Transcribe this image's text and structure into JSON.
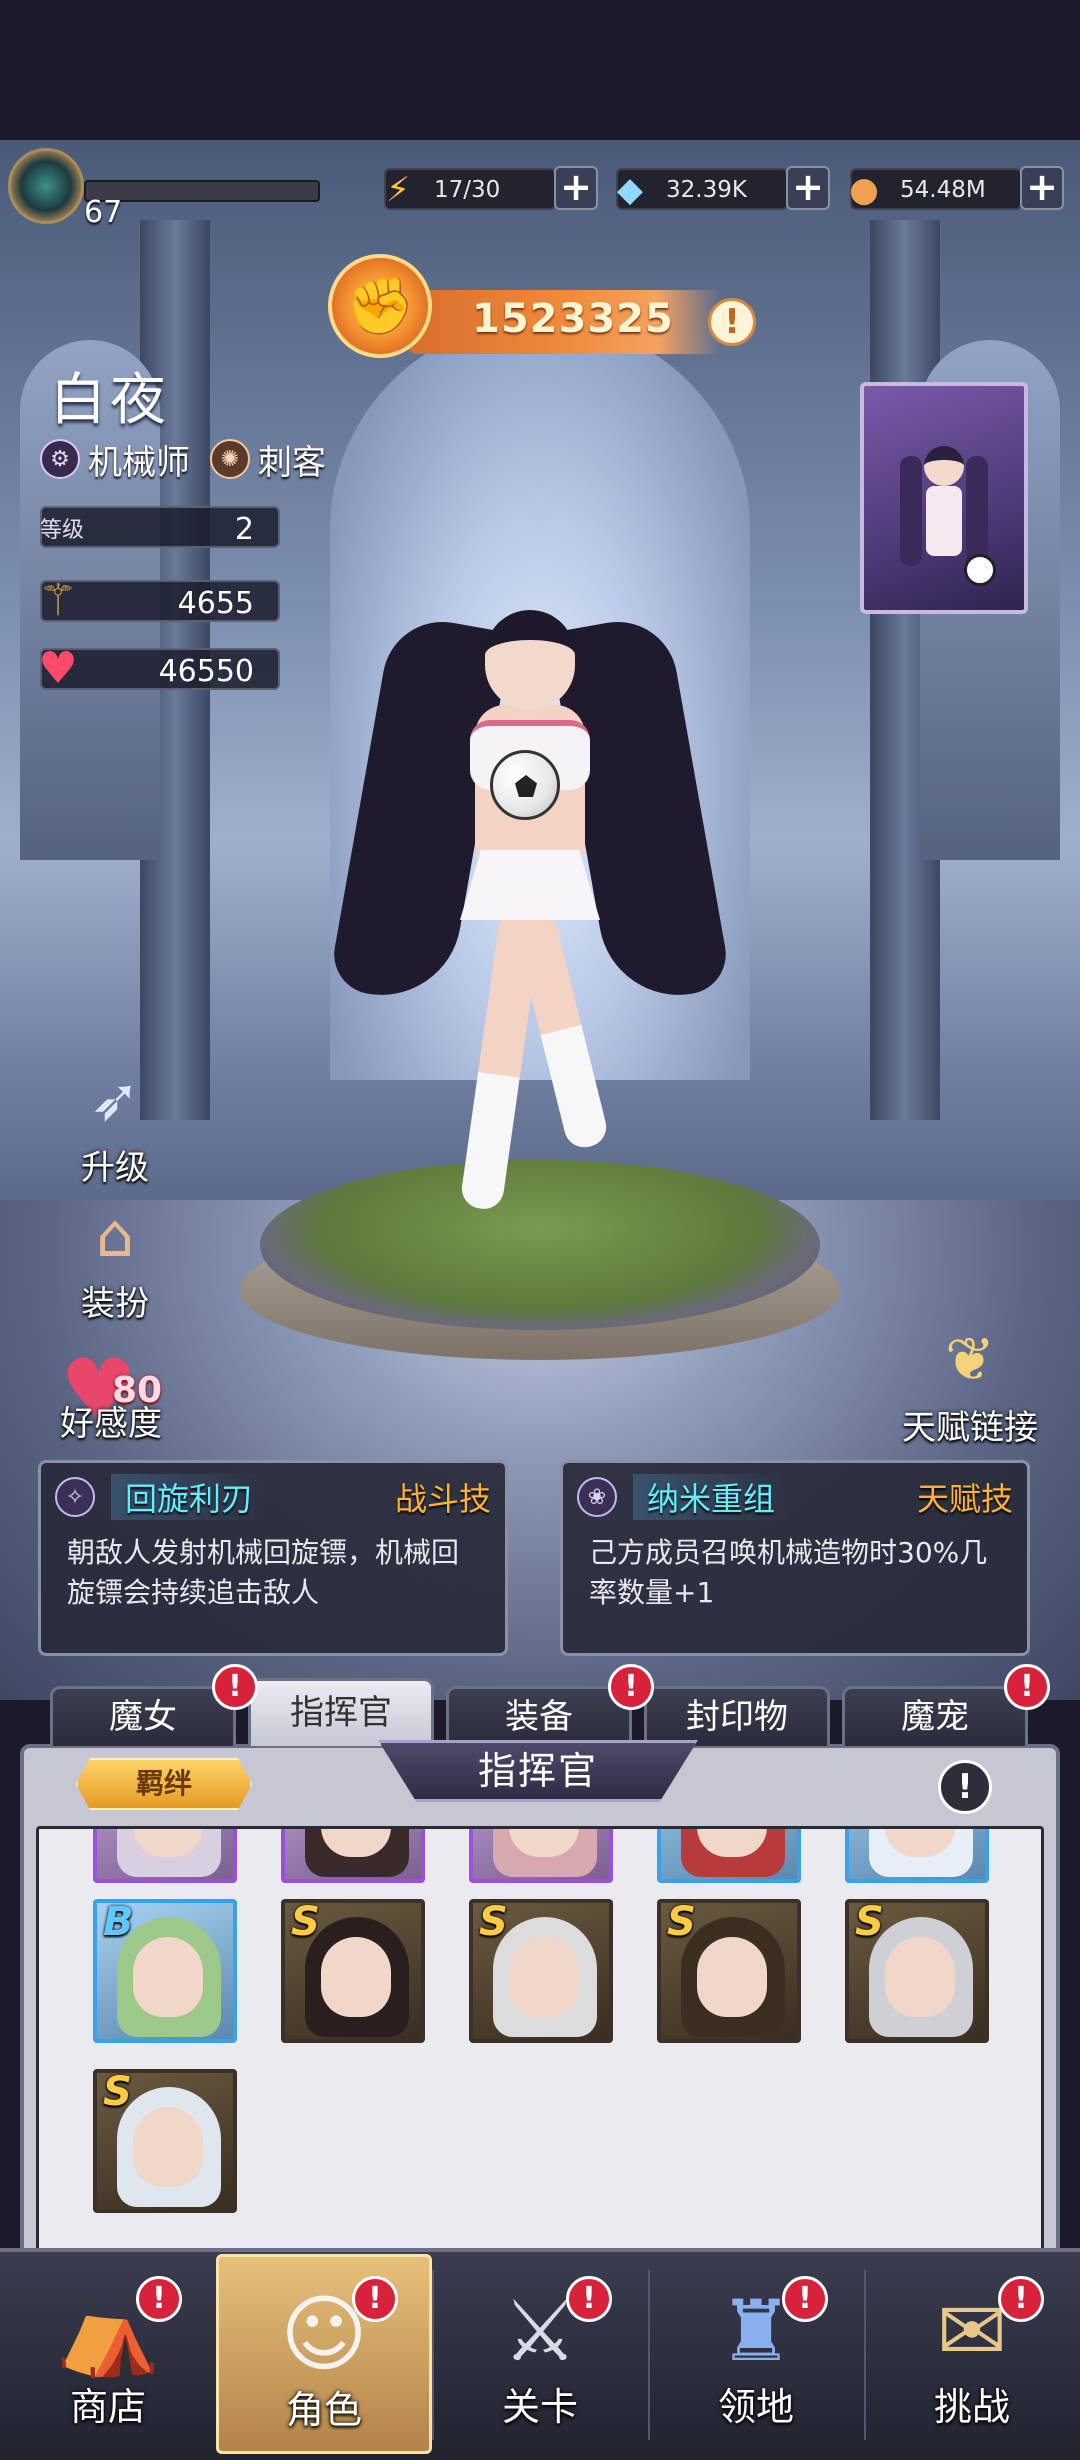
{
  "topbar": {
    "player_level": "67",
    "resources": [
      {
        "icon": "lightning-icon",
        "value": "17/30"
      },
      {
        "icon": "diamond-icon",
        "value": "32.39K"
      },
      {
        "icon": "coin-icon",
        "value": "54.48M"
      }
    ],
    "plus_label": "+"
  },
  "power": {
    "value": "1523325",
    "info": "!"
  },
  "character": {
    "name": "白夜",
    "classes": [
      {
        "icon": "gear-class-icon",
        "label": "机械师"
      },
      {
        "icon": "spiral-class-icon",
        "label": "刺客"
      }
    ],
    "stats": {
      "level_label": "等级",
      "level": "2",
      "attack": "4655",
      "hp": "46550"
    },
    "affection": "80"
  },
  "side_actions": {
    "upgrade": "升级",
    "dressup": "装扮",
    "affection": "好感度",
    "talent_link": "天赋链接"
  },
  "skills": [
    {
      "name": "回旋利刃",
      "type": "战斗技",
      "desc": "朝敌人发射机械回旋镖，机械回旋镖会持续追击敌人"
    },
    {
      "name": "纳米重组",
      "type": "天赋技",
      "desc": "己方成员召唤机械造物时30%几率数量+1"
    }
  ],
  "tabs": [
    {
      "label": "魔女",
      "alert": true
    },
    {
      "label": "指挥官",
      "alert": false,
      "active": true
    },
    {
      "label": "装备",
      "alert": true
    },
    {
      "label": "封印物",
      "alert": false
    },
    {
      "label": "魔宠",
      "alert": true
    }
  ],
  "panel": {
    "title": "指挥官",
    "bond_button": "羁绊",
    "info": "!",
    "cards_row2_ranks": [
      "B",
      "S",
      "S",
      "S",
      "S"
    ],
    "cards_row3_ranks": [
      "S"
    ]
  },
  "nav": [
    {
      "label": "商店",
      "icon": "shop-icon",
      "alert": true
    },
    {
      "label": "角色",
      "icon": "character-icon",
      "alert": true,
      "active": true
    },
    {
      "label": "关卡",
      "icon": "crossed-swords-icon",
      "alert": true
    },
    {
      "label": "领地",
      "icon": "castle-icon",
      "alert": true
    },
    {
      "label": "挑战",
      "icon": "scroll-map-icon",
      "alert": true
    }
  ],
  "alert_mark": "!"
}
